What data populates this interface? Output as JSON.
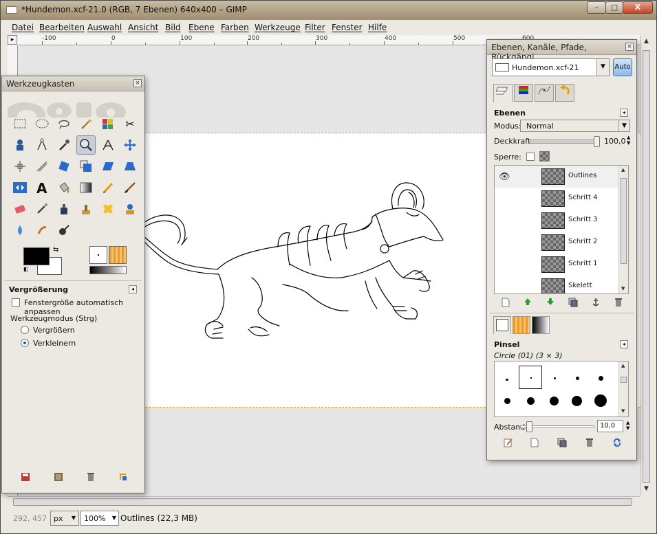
{
  "window": {
    "title": "*Hundemon.xcf-21.0 (RGB, 7 Ebenen) 640x400 – GIMP"
  },
  "menu": [
    "Datei",
    "Bearbeiten",
    "Auswahl",
    "Ansicht",
    "Bild",
    "Ebene",
    "Farben",
    "Werkzeuge",
    "Filter",
    "Fenster",
    "Hilfe"
  ],
  "ruler": {
    "labels": [
      "-100",
      "0",
      "100",
      "200",
      "300",
      "400",
      "500",
      "600"
    ]
  },
  "toolbox": {
    "title": "Werkzeugkasten",
    "options_title": "Vergrößerung",
    "auto_resize_label": "Fenstergröße automatisch anpassen",
    "mode_label": "Werkzeugmodus (Strg)",
    "mode_in": "Vergrößern",
    "mode_out": "Verkleinern",
    "selected_mode": "Verkleinern"
  },
  "layers_dock": {
    "title": "Ebenen, Kanäle, Pfade, Rückgängi...",
    "image_name": "Hundemon.xcf-21",
    "auto_label": "Auto",
    "section_title": "Ebenen",
    "mode_label": "Modus:",
    "mode_value": "Normal",
    "opacity_label": "Deckkraft:",
    "opacity_value": "100,0",
    "lock_label": "Sperre:",
    "layers": [
      {
        "name": "Outlines",
        "visible": true,
        "selected": true
      },
      {
        "name": "Schritt 4",
        "visible": false,
        "selected": false
      },
      {
        "name": "Schritt 3",
        "visible": false,
        "selected": false
      },
      {
        "name": "Schritt 2",
        "visible": false,
        "selected": false
      },
      {
        "name": "Schritt 1",
        "visible": false,
        "selected": false
      },
      {
        "name": "Skelett",
        "visible": false,
        "selected": false
      }
    ]
  },
  "brushes": {
    "section_title": "Pinsel",
    "current": "Circle (01) (3 × 3)",
    "spacing_label": "Abstand:",
    "spacing_value": "10,0"
  },
  "status": {
    "coords": "292, 457",
    "unit": "px",
    "zoom": "100%",
    "message": "Outlines (22,3 MB)"
  }
}
